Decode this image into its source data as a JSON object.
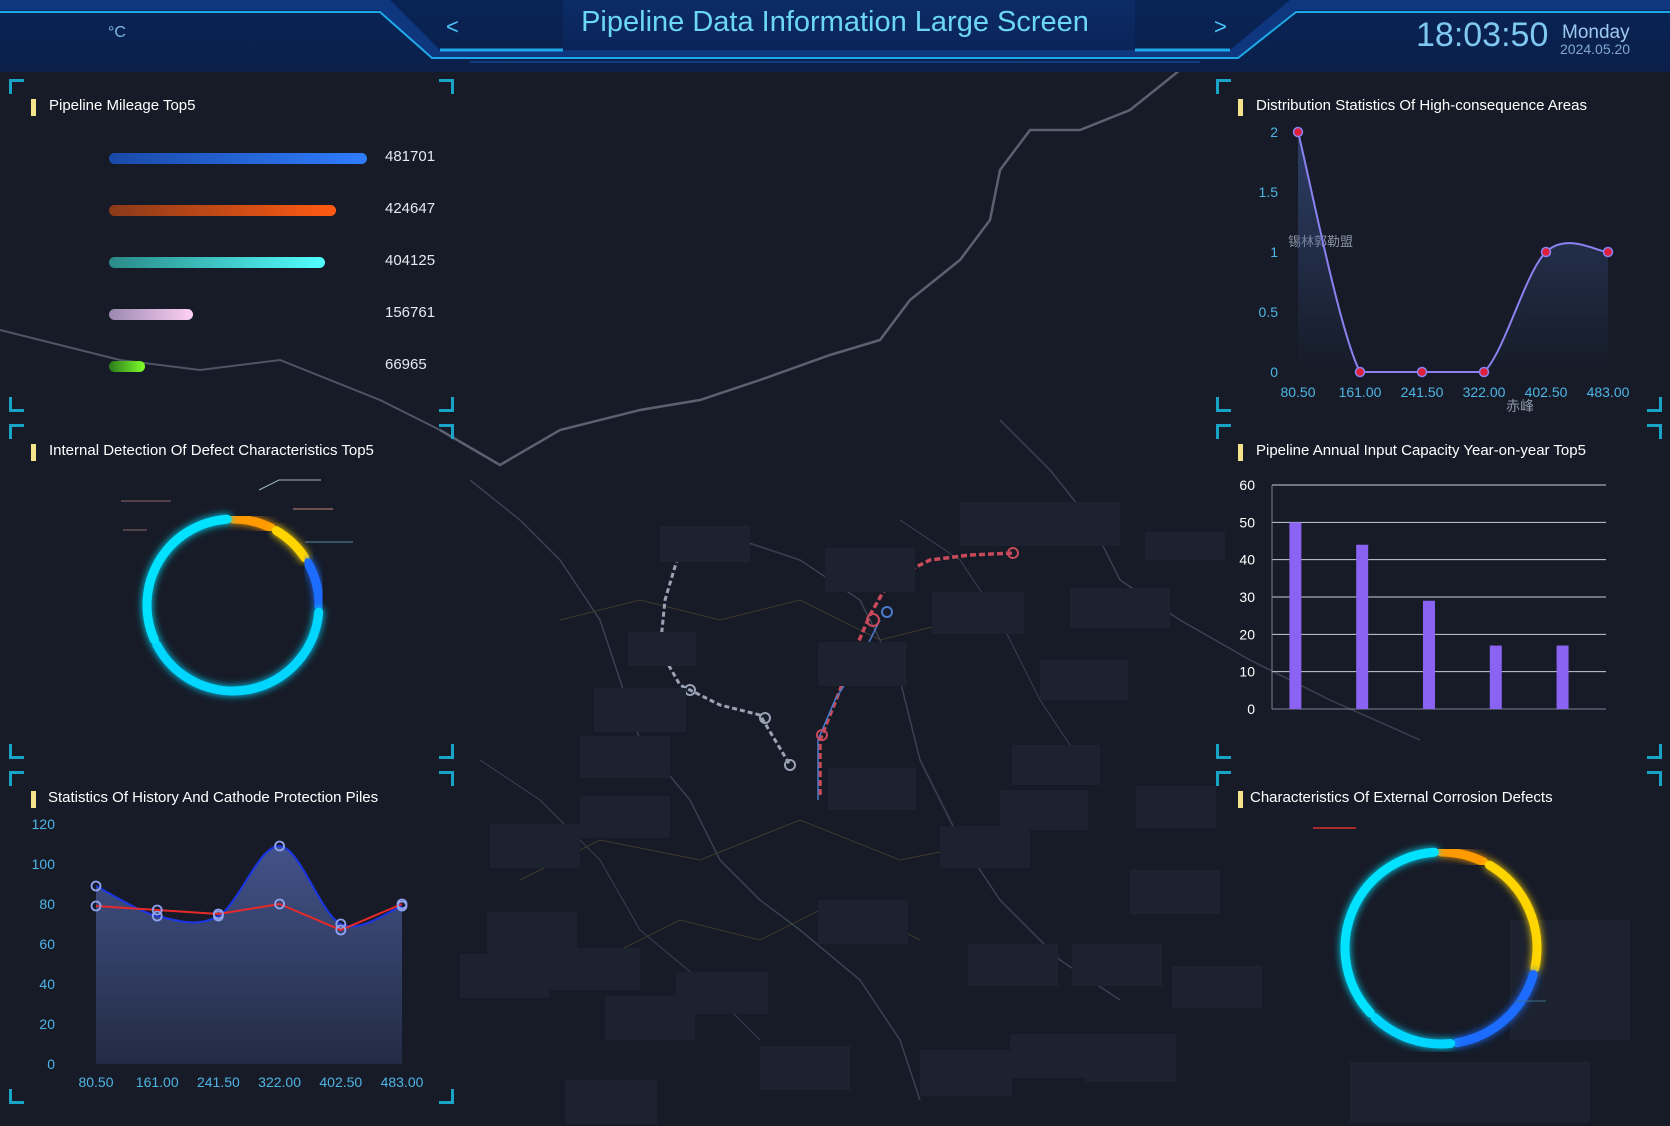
{
  "header": {
    "title": "Pipeline Data Information Large Screen",
    "temperature_unit": "°C",
    "prev_label": "<",
    "next_label": ">",
    "time": "18:03:50",
    "weekday": "Monday",
    "date": "2024.05.20"
  },
  "map": {
    "labels": [
      "锡林郭勒盟",
      "赤峰"
    ]
  },
  "panels": {
    "mileage": {
      "title": "Pipeline Mileage Top5",
      "max": 481701,
      "items": [
        {
          "value": "481701",
          "amount": 481701,
          "color_from": "#1a4aa8",
          "color_to": "#2f7dff"
        },
        {
          "value": "424647",
          "amount": 424647,
          "color_from": "#8a3a1a",
          "color_to": "#ff5a12"
        },
        {
          "value": "404125",
          "amount": 404125,
          "color_from": "#2a8a88",
          "color_to": "#52ffff"
        },
        {
          "value": "156761",
          "amount": 156761,
          "color_from": "#9a88b0",
          "color_to": "#ffd0f5"
        },
        {
          "value": "66965",
          "amount": 66965,
          "color_from": "#2a7a1a",
          "color_to": "#7dff2a"
        }
      ]
    },
    "internal_defects": {
      "title": "Internal Detection Of Defect Characteristics Top5"
    },
    "cathode": {
      "title": "Statistics Of History And Cathode Protection Piles"
    },
    "high_consequence": {
      "title": "Distribution Statistics Of  High-consequence Areas"
    },
    "annual_input": {
      "title": "Pipeline Annual Input Capacity Year-on-year Top5"
    },
    "external_corrosion": {
      "title": "Characteristics Of External Corrosion Defects"
    }
  },
  "chart_data": [
    {
      "type": "line",
      "title": "Distribution Statistics Of  High-consequence Areas",
      "x": [
        "80.50",
        "161.00",
        "241.50",
        "322.00",
        "402.50",
        "483.00"
      ],
      "yticks": [
        "0",
        "0.5",
        "1",
        "1.5",
        "2"
      ],
      "ylim": [
        0,
        2
      ],
      "series": [
        {
          "values": [
            2,
            0,
            0,
            0,
            1,
            1
          ]
        }
      ],
      "grid": false
    },
    {
      "type": "bar",
      "title": "Pipeline Annual Input Capacity Year-on-year Top5",
      "yticks": [
        "0",
        "10",
        "20",
        "30",
        "40",
        "50",
        "60"
      ],
      "ylim": [
        0,
        60
      ],
      "values": [
        50,
        44,
        29,
        17,
        17
      ],
      "color": "#8a63f2",
      "grid": true
    },
    {
      "type": "area",
      "title": "Statistics Of History And Cathode Protection Piles",
      "x": [
        "80.50",
        "161.00",
        "241.50",
        "322.00",
        "402.50",
        "483.00"
      ],
      "yticks": [
        "0",
        "20",
        "40",
        "60",
        "80",
        "100",
        "120"
      ],
      "ylim": [
        0,
        120
      ],
      "series": [
        {
          "values": [
            89,
            74,
            74,
            109,
            70,
            79
          ],
          "color": "#1b35e6"
        },
        {
          "values": [
            79,
            77,
            75,
            80,
            67,
            80
          ],
          "color": "#e62a2a"
        }
      ]
    },
    {
      "type": "pie",
      "title": "Internal Detection Of Defect Characteristics Top5",
      "segments": [
        {
          "value": 8,
          "color": "#ff9a00"
        },
        {
          "value": 8,
          "color": "#ffd500"
        },
        {
          "value": 9,
          "color": "#1e6cff"
        },
        {
          "value": 40,
          "color": "#00d6ff"
        },
        {
          "value": 30,
          "color": "#00e2ff"
        }
      ]
    },
    {
      "type": "pie",
      "title": "Characteristics Of External Corrosion Defects",
      "segments": [
        {
          "value": 8,
          "color": "#ff9a00"
        },
        {
          "value": 20,
          "color": "#ffd500"
        },
        {
          "value": 18,
          "color": "#1e6cff"
        },
        {
          "value": 14,
          "color": "#00d6ff"
        },
        {
          "value": 35,
          "color": "#00e2ff"
        }
      ]
    }
  ]
}
